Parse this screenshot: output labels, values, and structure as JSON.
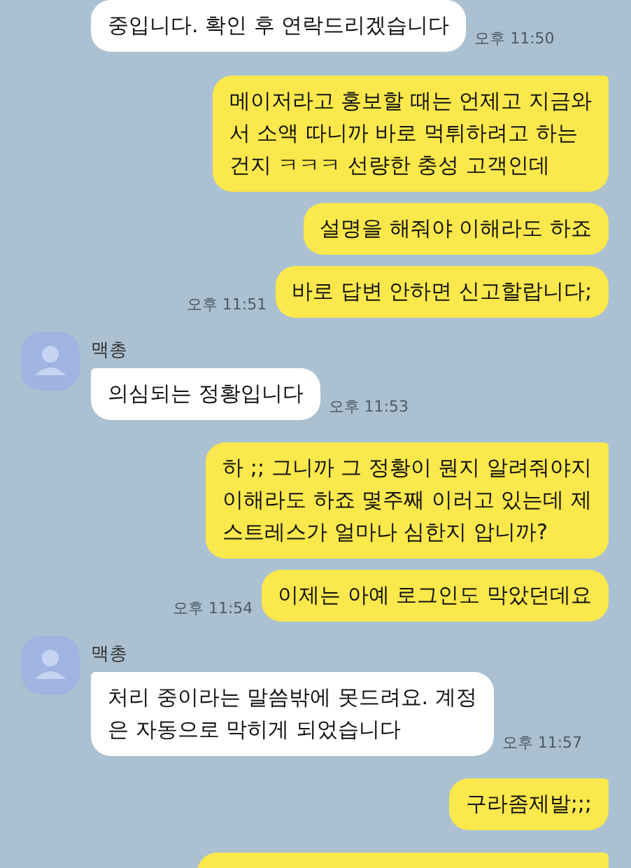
{
  "messages": [
    {
      "kind": "received",
      "text": "중입니다. 확인 후 연락드리겠습니다",
      "time": "오후 11:50",
      "tail": false
    },
    {
      "kind": "sent",
      "text": "메이저라고 홍보할 때는 언제고 지금와\n서 소액 따니까 바로 먹튀하려고 하는\n건지 ㅋㅋㅋ 선량한 충성 고객인데",
      "tail": true
    },
    {
      "kind": "sent",
      "text": "설명을 해줘야 이해라도 하죠",
      "tail": false
    },
    {
      "kind": "sent",
      "text": "바로 답변 안하면 신고할랍니다;",
      "time": "오후 11:51",
      "tail": false
    },
    {
      "kind": "received",
      "sender": "맥총",
      "text": "의심되는 정황입니다",
      "time": "오후 11:53",
      "tail": true
    },
    {
      "kind": "sent",
      "text": "하 ;; 그니까 그 정황이 뭔지 알려줘야지\n이해라도 하죠 몇주째 이러고 있는데 제\n스트레스가 얼마나 심한지 압니까?",
      "tail": true
    },
    {
      "kind": "sent",
      "text": "이제는 아예 로그인도 막았던데요",
      "time": "오후 11:54",
      "tail": false
    },
    {
      "kind": "received",
      "sender": "맥총",
      "text": "처리 중이라는 말씀밖에 못드려요. 계정\n은 자동으로 막히게 되었습니다",
      "time": "오후 11:57",
      "tail": true
    },
    {
      "kind": "sent",
      "text": "구라좀제발;;;",
      "tail": true
    },
    {
      "kind": "sent",
      "tail": true
    }
  ]
}
